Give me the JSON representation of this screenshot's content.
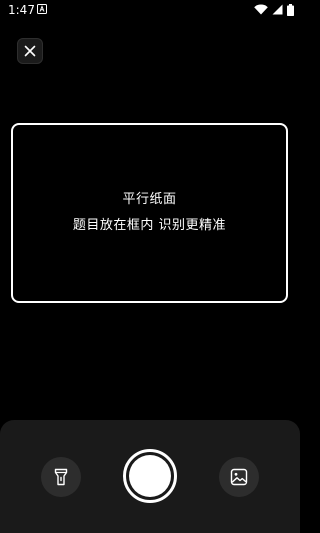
{
  "status_bar": {
    "time": "1:47",
    "icons": [
      "notification-a-icon",
      "wifi-icon",
      "cellular-signal-icon",
      "battery-icon"
    ]
  },
  "camera": {
    "close_icon": "close-icon",
    "hint": {
      "line1": "平行纸面",
      "line2": "题目放在框内 识别更精准"
    },
    "controls": {
      "left_icon": "flashlight-icon",
      "shutter": "shutter-button",
      "right_icon": "gallery-icon"
    }
  },
  "colors": {
    "background": "#000000",
    "panel": "#1a1a1a",
    "side_button": "#2d2d2d",
    "foreground": "#ffffff"
  }
}
